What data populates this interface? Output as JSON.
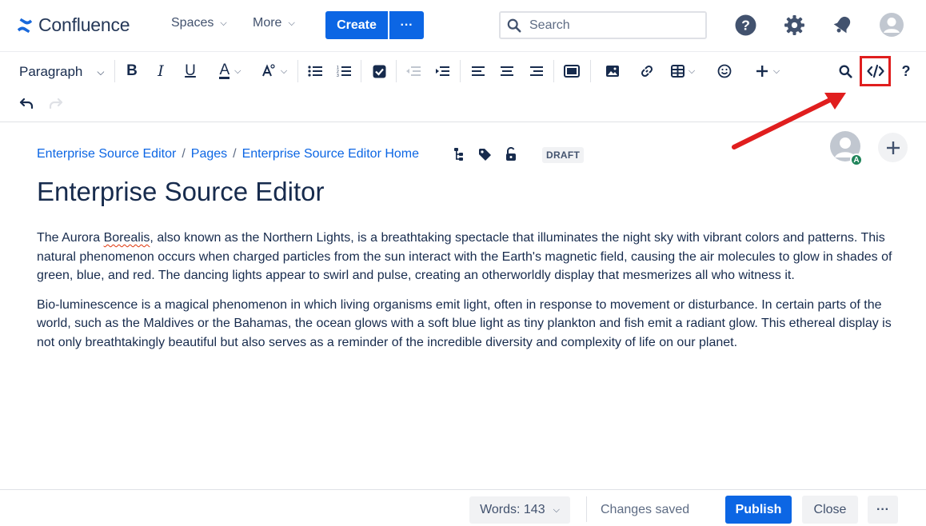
{
  "app": {
    "name": "Confluence"
  },
  "nav": {
    "spaces_label": "Spaces",
    "more_label": "More",
    "create_label": "Create",
    "create_more_label": "···",
    "search_placeholder": "Search"
  },
  "toolbar": {
    "paragraph_label": "Paragraph",
    "bold_label": "B",
    "italic_label": "I",
    "underline_label": "U",
    "text_color_label": "A",
    "help_label": "?"
  },
  "breadcrumbs": [
    {
      "label": "Enterprise Source Editor"
    },
    {
      "label": "Pages"
    },
    {
      "label": "Enterprise Source Editor Home"
    }
  ],
  "breadcrumb_separator": "/",
  "status_badge": "DRAFT",
  "avatar_badge": "A",
  "page": {
    "title": "Enterprise Source Editor",
    "p1_before": "The Aurora ",
    "p1_misspelled": "Borealis",
    "p1_after": ", also known as the Northern Lights, is a breathtaking spectacle that illuminates the night sky with vibrant colors and patterns. This natural phenomenon occurs when charged particles from the sun interact with the Earth's magnetic field, causing the air molecules to glow in shades of green, blue, and red. The dancing lights appear to swirl and pulse, creating an otherworldly display that mesmerizes all who witness it.",
    "p2": "Bio-luminescence is a magical phenomenon in which living organisms emit light, often in response to movement or disturbance. In certain parts of the world, such as the Maldives or the Bahamas, the ocean glows with a soft blue light as tiny plankton and fish emit a radiant glow. This ethereal display is not only breathtakingly beautiful but also serves as a reminder of the incredible diversity and complexity of life on our planet."
  },
  "footer": {
    "words_label": "Words: 143",
    "status_text": "Changes saved",
    "publish_label": "Publish",
    "close_label": "Close",
    "more_label": "···"
  },
  "colors": {
    "brand_blue": "#0c66e4",
    "highlight_red": "#e01e1e",
    "text": "#172b4d",
    "link": "#0c66e4"
  }
}
